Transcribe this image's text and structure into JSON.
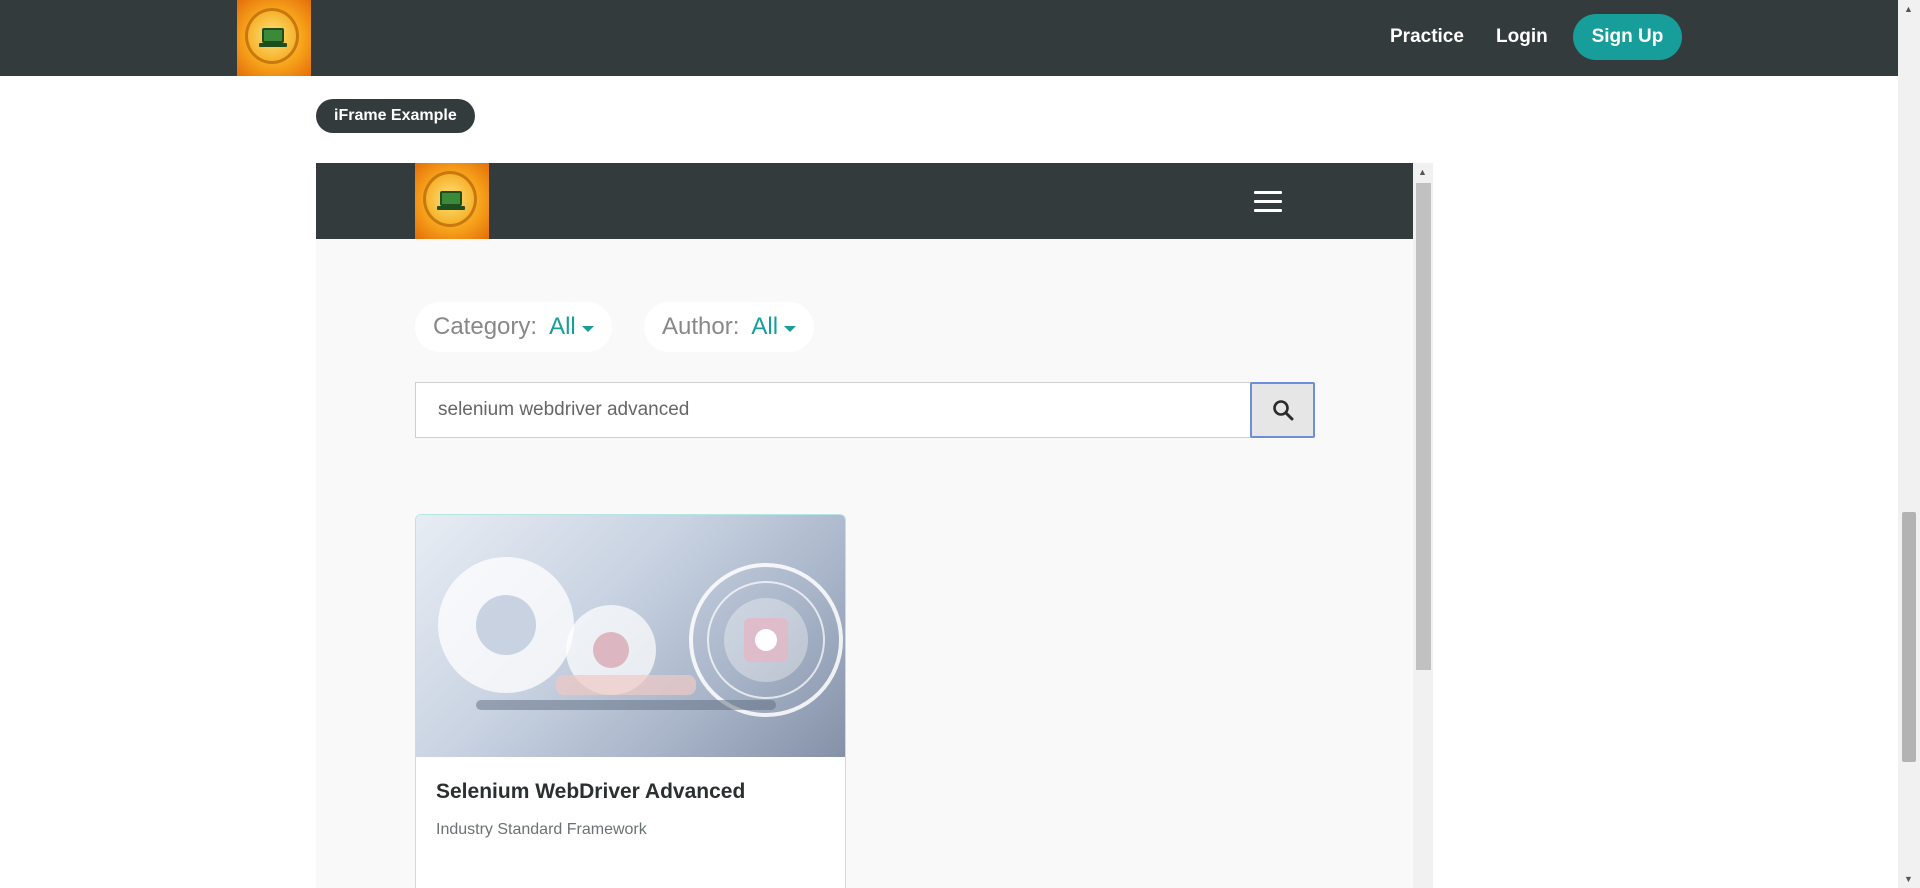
{
  "header": {
    "logo_icon": "lets-kode-it-logo-icon",
    "nav": {
      "practice": "Practice",
      "login": "Login",
      "signup": "Sign Up"
    },
    "colors": {
      "bar": "#333b3c",
      "accent": "#179e9a"
    }
  },
  "badge": {
    "label": "iFrame Example"
  },
  "iframe": {
    "menu_icon": "hamburger-menu-icon",
    "filters": {
      "category_label": "Category:",
      "category_value": "All",
      "author_label": "Author:",
      "author_value": "All"
    },
    "search": {
      "value": "selenium webdriver advanced",
      "button_icon": "search-icon"
    },
    "course": {
      "title": "Selenium WebDriver Advanced",
      "subtitle": "Industry Standard Framework"
    }
  }
}
